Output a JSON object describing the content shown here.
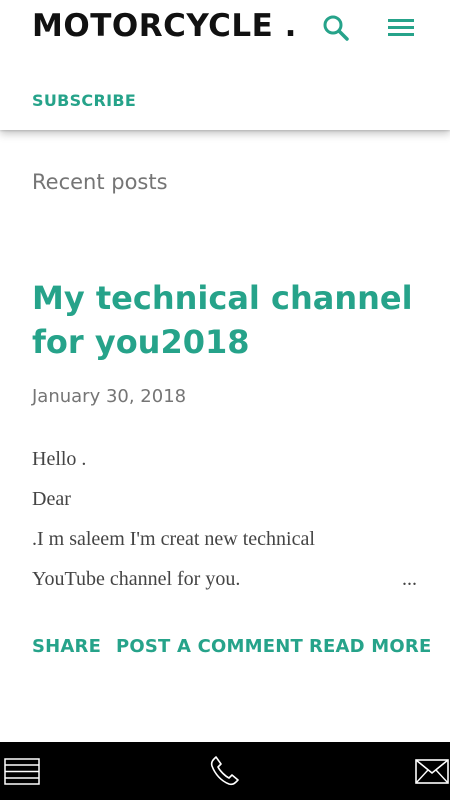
{
  "colors": {
    "accent": "#26a38a",
    "title_text": "#111111",
    "muted": "#757575",
    "bottom_bar": "#000000"
  },
  "header": {
    "site_title": "MOTORCYCLE ...",
    "search_icon": "search-icon",
    "menu_icon": "hamburger-menu-icon",
    "subscribe_label": "SUBSCRIBE"
  },
  "section_label": "Recent posts",
  "post": {
    "title": "My technical channel for you2018",
    "date": "January 30, 2018",
    "snippet": [
      "Hello .",
      "Dear",
      ".I m saleem I'm creat new technical",
      "YouTube channel for you."
    ],
    "ellipsis": "...",
    "actions": {
      "share": "SHARE",
      "comment": "POST A COMMENT",
      "read_more": "READ MORE"
    }
  },
  "bottom_bar": {
    "menu_icon": "list-icon",
    "phone_icon": "phone-icon",
    "mail_icon": "mail-icon"
  }
}
